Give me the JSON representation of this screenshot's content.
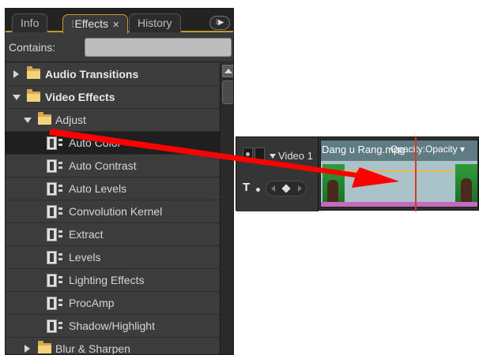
{
  "effects_panel": {
    "tabs": [
      {
        "label": "Info",
        "active": false
      },
      {
        "label": "Effects",
        "active": true,
        "close": "✕"
      },
      {
        "label": "History",
        "active": false
      }
    ],
    "tab_menu_glyph": "⁝▶",
    "search": {
      "label": "Contains:",
      "value": ""
    },
    "tree": [
      {
        "label": "Audio Transitions",
        "type": "folder",
        "level": 0,
        "expanded": false
      },
      {
        "label": "Video Effects",
        "type": "folder",
        "level": 0,
        "expanded": true
      },
      {
        "label": "Adjust",
        "type": "folder",
        "level": 1,
        "expanded": true
      },
      {
        "label": "Auto Color",
        "type": "effect",
        "selected": true
      },
      {
        "label": "Auto Contrast",
        "type": "effect"
      },
      {
        "label": "Auto Levels",
        "type": "effect"
      },
      {
        "label": "Convolution Kernel",
        "type": "effect"
      },
      {
        "label": "Extract",
        "type": "effect"
      },
      {
        "label": "Levels",
        "type": "effect"
      },
      {
        "label": "Lighting Effects",
        "type": "effect"
      },
      {
        "label": "ProcAmp",
        "type": "effect"
      },
      {
        "label": "Shadow/Highlight",
        "type": "effect"
      },
      {
        "label": "Blur & Sharpen",
        "type": "folder",
        "level": 1,
        "expanded": false
      }
    ]
  },
  "timeline": {
    "track_name": "Video 1",
    "title_tool": "T",
    "clip": {
      "name": "Dang u Rang.mpg",
      "opacity_label": "Opacity:Opacity ▾"
    }
  },
  "annotation": {
    "arrow_color": "#ff0000"
  },
  "colors": {
    "panel_bg": "#3a3a3a",
    "active_tab_border": "#c49a2a",
    "folder": "#f3d27c",
    "clip_body": "#a9c3c8",
    "playhead": "#d23a2a"
  }
}
